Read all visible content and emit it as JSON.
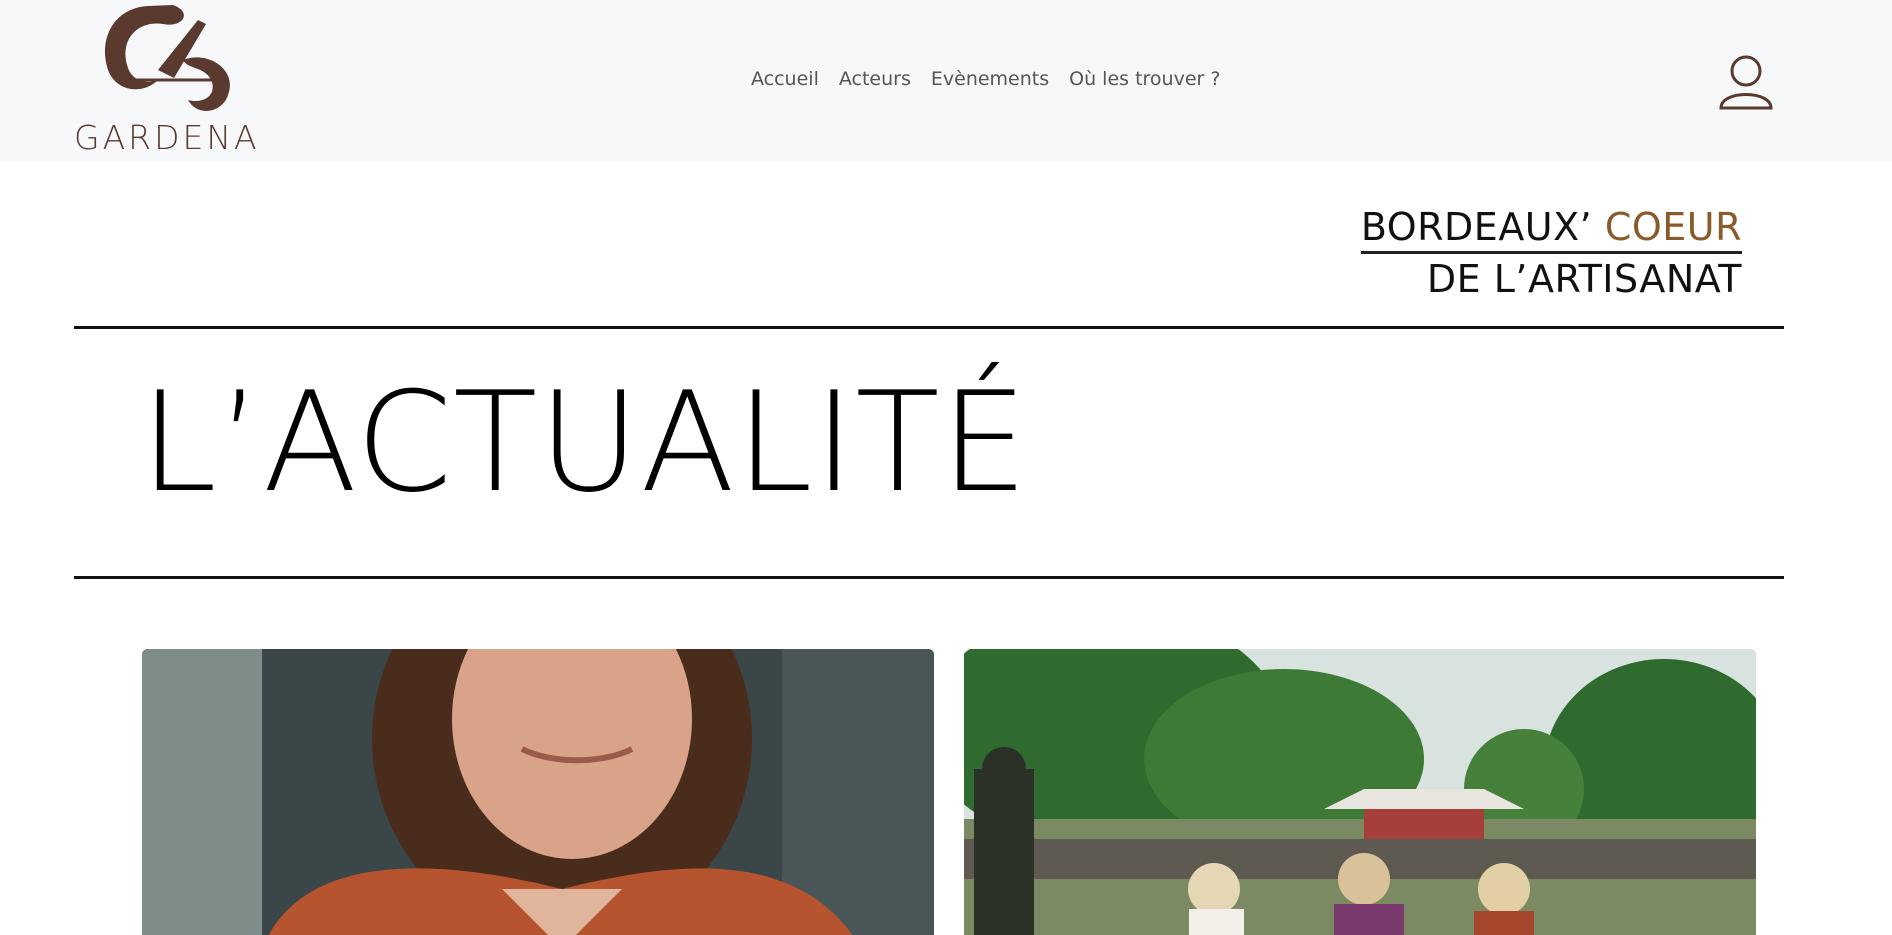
{
  "brand": {
    "name": "GARDENA"
  },
  "nav": {
    "items": [
      {
        "label": "Accueil"
      },
      {
        "label": "Acteurs"
      },
      {
        "label": "Evènements"
      },
      {
        "label": "Où les trouver ?"
      }
    ]
  },
  "tagline": {
    "line1_main": "BORDEAUX’",
    "line1_accent": "COEUR",
    "line2": "DE L’ARTISANAT"
  },
  "page": {
    "title": "L’ACTUALITÉ"
  },
  "colors": {
    "brand_brown": "#5a3a2e",
    "accent": "#8a5a2a",
    "header_bg": "#f7f8fa"
  },
  "icons": {
    "user": "user-icon"
  }
}
